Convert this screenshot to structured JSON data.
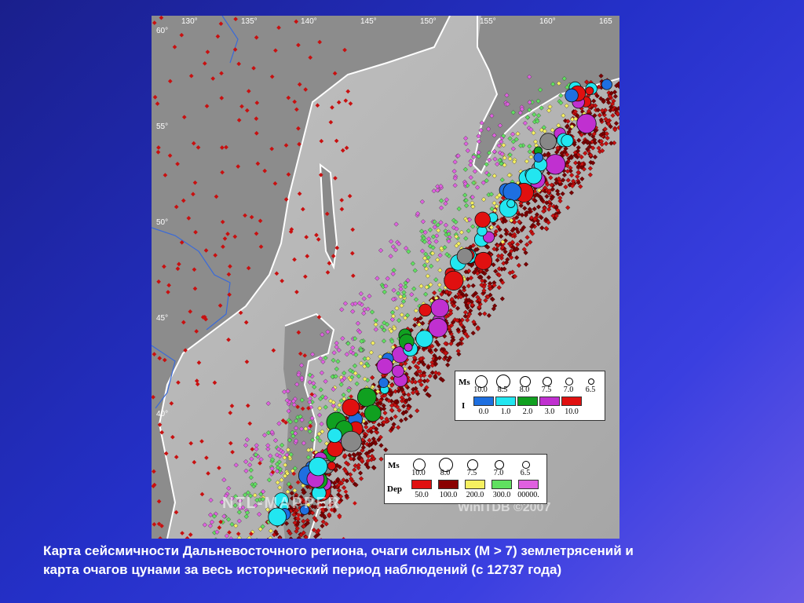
{
  "map": {
    "lon_labels": [
      "130°",
      "135°",
      "140°",
      "145°",
      "150°",
      "155°",
      "160°",
      "165"
    ],
    "lat_labels": [
      "60°",
      "55°",
      "50°",
      "45°",
      "40°"
    ],
    "watermark_left": "WINITDB ©2007",
    "watermark_right": "WinITDB ©2007",
    "watermark_logo_text": "NTL-MAPPER",
    "colors": {
      "land": "#8f8f8f",
      "sea": "#b8b8b8",
      "coast": "#ffffff",
      "border": "#3a6ad8",
      "event_red": "#c81010",
      "event_dark": "#7a0000"
    }
  },
  "legend_tsunami": {
    "ms_label": "Ms",
    "i_label": "I",
    "ms_values": [
      "10.0",
      "8.5",
      "8.0",
      "7.5",
      "7.0",
      "6.5"
    ],
    "i_values": [
      "0.0",
      "1.0",
      "2.0",
      "3.0",
      "10.0"
    ],
    "i_colors": [
      "#1e6fe0",
      "#22e6f0",
      "#10a020",
      "#c030d0",
      "#e01010"
    ]
  },
  "legend_quake": {
    "ms_label": "Ms",
    "dep_label": "Dep",
    "ms_values": [
      "10.0",
      "8.0",
      "7.5",
      "7.0",
      "6.5"
    ],
    "dep_values": [
      "50.0",
      "100.0",
      "200.0",
      "300.0",
      "00000."
    ],
    "dep_colors": [
      "#e01010",
      "#8a0000",
      "#f6f060",
      "#60e060",
      "#e060e0"
    ]
  },
  "caption": {
    "line1": "Карта сейсмичности Дальневосточного региона, очаги сильных (М > 7) землетрясений и",
    "line2": "карта очагов цунами за весь исторический период наблюдений (с 12737 года)"
  }
}
